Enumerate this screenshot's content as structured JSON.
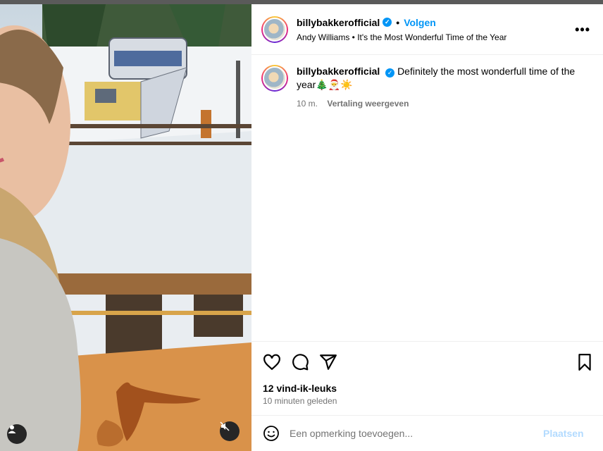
{
  "post": {
    "username": "billybakkerofficial",
    "follow_label": "Volgen",
    "audio": "Andy Williams • It's the Most Wonderful Time of the Year",
    "more_label": "•••",
    "caption_user": "billybakkerofficial",
    "caption_text": "Definitely the most wonderfull time of the year🎄🎅☀️",
    "caption_age": "10 m.",
    "translate_label": "Vertaling weergeven",
    "likes": "12 vind-ik-leuks",
    "time_ago": "10 minuten geleden",
    "comment_placeholder": "Een opmerking toevoegen...",
    "post_label": "Plaatsen"
  },
  "colors": {
    "accent": "#0095f6",
    "muted": "#737373",
    "post_disabled": "#b3dbff"
  },
  "icons": [
    "heart-icon",
    "comment-icon",
    "share-icon",
    "bookmark-icon",
    "emoji-icon",
    "user-tag-icon",
    "mute-icon",
    "verified-badge-icon"
  ]
}
